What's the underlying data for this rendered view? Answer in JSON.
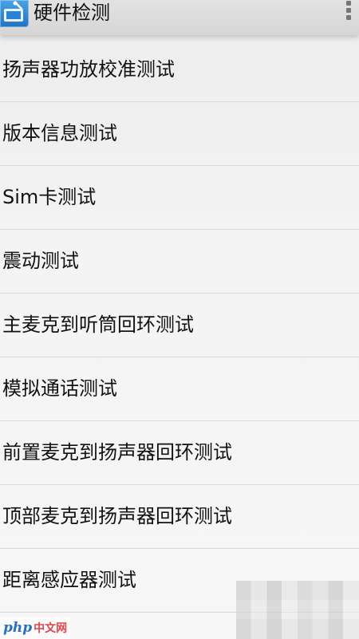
{
  "header": {
    "title": "硬件检测",
    "app_icon": "hardware-test-app-icon",
    "overflow_icon": "overflow-menu-icon"
  },
  "list": {
    "items": [
      {
        "label": "扬声器功放校准测试"
      },
      {
        "label": "版本信息测试"
      },
      {
        "label": "Sim卡测试"
      },
      {
        "label": "震动测试"
      },
      {
        "label": "主麦克到听筒回环测试"
      },
      {
        "label": "模拟通话测试"
      },
      {
        "label": "前置麦克到扬声器回环测试"
      },
      {
        "label": "顶部麦克到扬声器回环测试"
      },
      {
        "label": "距离感应器测试"
      }
    ]
  },
  "watermark": {
    "logo": "php",
    "text": "中文网"
  },
  "colors": {
    "action_bar": "#dcdcdc",
    "background": "#f3f3f3",
    "divider": "#d8d8d8",
    "icon_blue": "#2a83d6"
  }
}
